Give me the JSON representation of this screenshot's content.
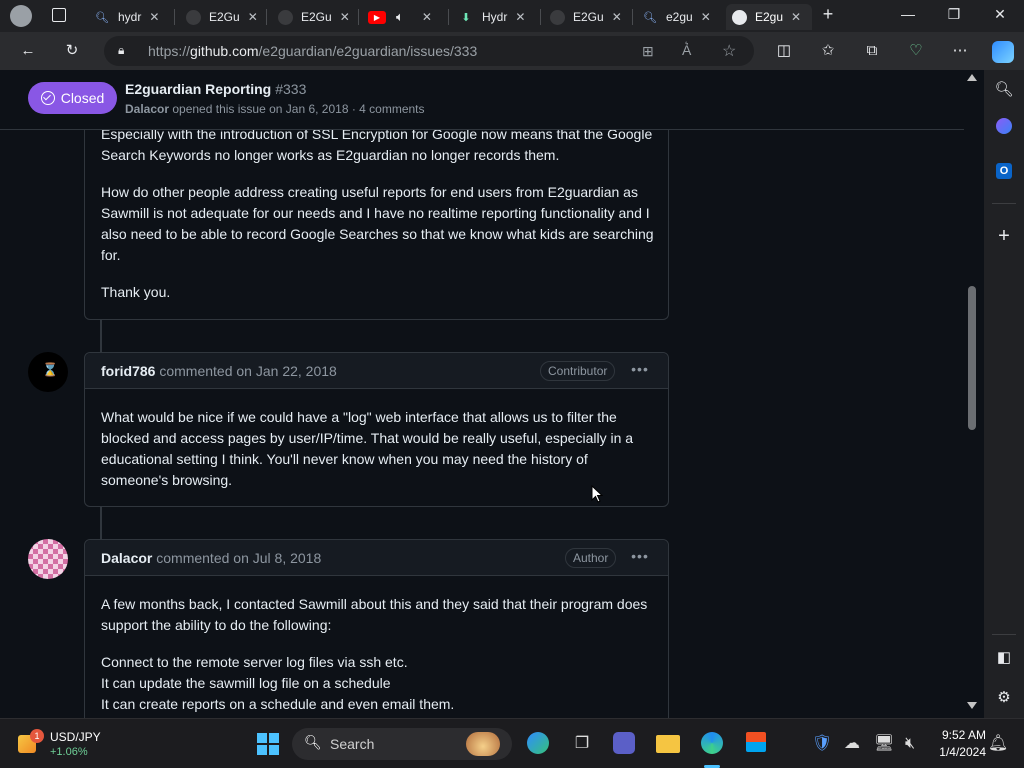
{
  "browser": {
    "tabs": [
      {
        "label": "hydr",
        "icon": "search-icon"
      },
      {
        "label": "E2Gu",
        "icon": "github-icon"
      },
      {
        "label": "E2Gu",
        "icon": "github-icon"
      },
      {
        "label": "",
        "icon": "youtube-icon"
      },
      {
        "label": "Hydr",
        "icon": "download-icon"
      },
      {
        "label": "E2Gu",
        "icon": "github-icon"
      },
      {
        "label": "e2gu",
        "icon": "search-icon"
      },
      {
        "label": "E2gu",
        "icon": "github-icon",
        "active": true
      }
    ],
    "url_prefix": "https://",
    "url_host": "github.com",
    "url_path": "/e2guardian/e2guardian/issues/333"
  },
  "issue": {
    "status": "Closed",
    "title": "E2guardian Reporting",
    "number": "#333",
    "author": "Dalacor",
    "meta": " opened this issue on Jan 6, 2018 · 4 comments"
  },
  "first_comment": {
    "paragraphs": [
      "Especially with the introduction of SSL Encryption for Google now means that the Google Search Keywords no longer works as E2guardian no longer records them.",
      "How do other people address creating useful reports for end users from E2guardian as Sawmill is not adequate for our needs and I have no realtime reporting functionality and I also need to be able to record Google Searches so that we know what kids are searching for.",
      "Thank you."
    ]
  },
  "comments": [
    {
      "author": "forid786",
      "meta": "commented on Jan 22, 2018",
      "role": "Contributor",
      "paragraphs": [
        "What would be nice if we could have a \"log\" web interface that allows us to filter the blocked and access pages by user/IP/time. That would be really useful, especially in a educational setting I think. You'll never know when you may need the history of someone's browsing."
      ]
    },
    {
      "author": "Dalacor",
      "meta": "commented on Jul 8, 2018",
      "role": "Author",
      "paragraphs": [
        "A few months back, I contacted Sawmill about this and they said that their program does support the ability to do the following:",
        "Connect to the remote server log files via ssh etc.",
        "It can update the sawmill log file on a schedule",
        "It can create reports on a schedule and even email them."
      ]
    }
  ],
  "taskbar": {
    "ticker_name": "USD/JPY",
    "ticker_change": "+1.06%",
    "ticker_badge": "1",
    "search_label": "Search",
    "time": "9:52 AM",
    "date": "1/4/2024"
  },
  "colors": {
    "closed_badge": "#8957e5",
    "page_bg": "#0d1117",
    "border": "#30363d"
  }
}
